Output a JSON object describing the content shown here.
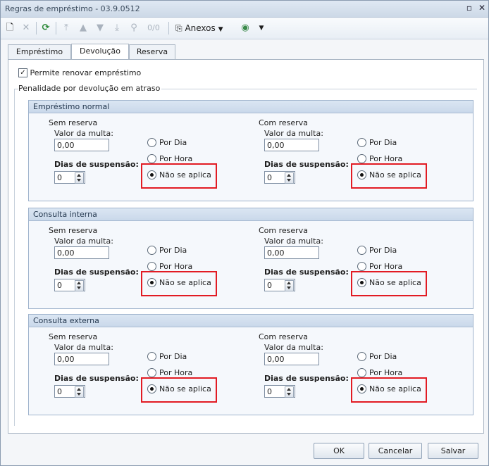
{
  "window": {
    "title": "Regras de empréstimo - 03.9.0512"
  },
  "toolbar": {
    "counter": "0/0",
    "anexos_label": "Anexos"
  },
  "tabs": [
    {
      "label": "Empréstimo"
    },
    {
      "label": "Devolução"
    },
    {
      "label": "Reserva"
    }
  ],
  "active_tab": "Devolução",
  "options": {
    "permite_renovar_label": "Permite renovar empréstimo",
    "permite_renovar_checked": true,
    "penalidade_label": "Penalidade por devolução em atraso"
  },
  "sections": [
    {
      "title": "Empréstimo normal",
      "left": {
        "title": "Sem reserva",
        "multa_label": "Valor da multa:",
        "multa_value": "0,00",
        "suspensao_label": "Dias de suspensão:",
        "suspensao_value": "0",
        "radio_por_dia": "Por Dia",
        "radio_por_hora": "Por Hora",
        "radio_nao_aplica": "Não se aplica",
        "selected": "Não se aplica"
      },
      "right": {
        "title": "Com reserva",
        "multa_label": "Valor da multa:",
        "multa_value": "0,00",
        "suspensao_label": "Dias de suspensão:",
        "suspensao_value": "0",
        "radio_por_dia": "Por Dia",
        "radio_por_hora": "Por Hora",
        "radio_nao_aplica": "Não se aplica",
        "selected": "Não se aplica"
      }
    },
    {
      "title": "Consulta interna",
      "left": {
        "title": "Sem reserva",
        "multa_label": "Valor da multa:",
        "multa_value": "0,00",
        "suspensao_label": "Dias de suspensão:",
        "suspensao_value": "0",
        "radio_por_dia": "Por Dia",
        "radio_por_hora": "Por Hora",
        "radio_nao_aplica": "Não se aplica",
        "selected": "Não se aplica"
      },
      "right": {
        "title": "Com reserva",
        "multa_label": "Valor da multa:",
        "multa_value": "0,00",
        "suspensao_label": "Dias de suspensão:",
        "suspensao_value": "0",
        "radio_por_dia": "Por Dia",
        "radio_por_hora": "Por Hora",
        "radio_nao_aplica": "Não se aplica",
        "selected": "Não se aplica"
      }
    },
    {
      "title": "Consulta externa",
      "left": {
        "title": "Sem reserva",
        "multa_label": "Valor da multa:",
        "multa_value": "0,00",
        "suspensao_label": "Dias de suspensão:",
        "suspensao_value": "0",
        "radio_por_dia": "Por Dia",
        "radio_por_hora": "Por Hora",
        "radio_nao_aplica": "Não se aplica",
        "selected": "Não se aplica"
      },
      "right": {
        "title": "Com reserva",
        "multa_label": "Valor da multa:",
        "multa_value": "0,00",
        "suspensao_label": "Dias de suspensão:",
        "suspensao_value": "0",
        "radio_por_dia": "Por Dia",
        "radio_por_hora": "Por Hora",
        "radio_nao_aplica": "Não se aplica",
        "selected": "Não se aplica"
      }
    }
  ],
  "footer": {
    "ok_label": "OK",
    "cancel_label": "Cancelar",
    "save_label": "Salvar"
  },
  "colors": {
    "highlight": "#e21b23",
    "section_header": "#c9d8ea"
  },
  "icons": [
    "new-document-icon",
    "delete-icon",
    "refresh-icon",
    "move-first-icon",
    "move-up-icon",
    "move-down-icon",
    "move-last-icon",
    "binoculars-icon",
    "paperclip-icon",
    "globe-icon",
    "dropdown-arrow-icon",
    "restore-icon",
    "close-icon"
  ]
}
